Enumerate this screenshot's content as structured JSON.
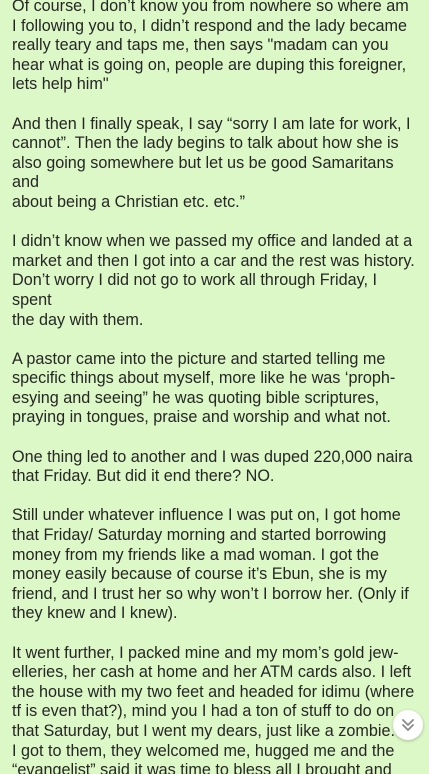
{
  "message": {
    "paragraphs": [
      "Of course, I don’t know you from nowhere so where am\nI following you to, I didn’t respond and the lady became\nreally teary and taps me, then  says \"madam can you\nhear what is going on, people are duping this foreigner,\nlets help him\"",
      "And then I finally speak, I say “sorry I am late for work, I\ncannot”. Then the lady begins to talk about how she is\nalso going somewhere but let us be good Samaritans\nand\nabout being a Christian etc. etc.”",
      "I didn’t know when we passed my office and landed at a\nmarket and then I got into a car and the rest was history.\nDon’t worry I did not go to work all through Friday, I spent\nthe day with them.",
      "A pastor came into the picture and started telling me\nspecific things about myself, more like he was ‘proph-\nesying and seeing” he was quoting bible scriptures,\npraying in tongues, praise and worship and what not.",
      "One thing led to another and I was duped 220,000 naira\nthat Friday. But did it end there? NO.",
      "Still under whatever influence I was put on, I got home\nthat Friday/ Saturday morning and started borrowing\nmoney from my friends like a mad woman. I got the\nmoney easily because of course it’s Ebun, she is my\nfriend, and I trust her so why won’t I borrow her. (Only if\nthey knew and I knew).",
      "It went further, I packed mine and my mom’s gold jew-\nelleries, her cash at home and her ATM cards also. I left\nthe house with my two feet and headed for idimu (where\ntf is even that?), mind you I had a ton of stuff to do on\nthat Saturday, but I went my dears, just like a zombie.\nI got to them, they welcomed me, hugged me and the\n“evangelist” said it was time to bless all I brought and"
    ]
  },
  "scroll_button": {
    "icon": "chevron-down-double-icon"
  },
  "colors": {
    "bubble_background": "#dcf8c6",
    "text": "#262626",
    "button_background": "#ffffff",
    "button_icon": "#8a8a8a"
  }
}
